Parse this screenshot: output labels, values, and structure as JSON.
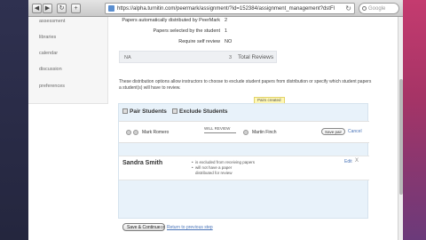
{
  "browser": {
    "url": "https://alpha.turnitin.com/peermark/assignment/?id=152384/assignment_management?dstFlag=1",
    "search_placeholder": "Google"
  },
  "sidebar": {
    "items": [
      {
        "label": "assessment"
      },
      {
        "label": "libraries"
      },
      {
        "label": "calendar"
      },
      {
        "label": "discussion"
      },
      {
        "label": "preferences"
      }
    ]
  },
  "settings": {
    "rows": [
      {
        "label": "Papers automatically distributed by PeerMark",
        "value": "2"
      },
      {
        "label": "Papers selected by the student",
        "value": "1"
      },
      {
        "label": "Require self review",
        "value": "NO"
      }
    ],
    "total": {
      "na": "NA",
      "count": "3",
      "label": "Total Reviews"
    }
  },
  "description": "These distribution options allow instructors to choose to exclude student papers from distribution or specify which student papers a student(s) will have to review.",
  "pairs_saved": "Pairs created",
  "tabs": {
    "pair_students": "Pair Students",
    "exclude_students": "Exclude Students"
  },
  "pair_row": {
    "reviewer": "Mark Romero",
    "will_review": "WILL REVIEW",
    "reviewee": "Martin Finch",
    "save_pair": "Save pair",
    "cancel": "Cancel"
  },
  "student": {
    "name": "Sandra Smith",
    "notes": [
      "is excluded from receiving papers",
      "will not have a paper distributed for review"
    ],
    "edit": "Edit",
    "delete": "X"
  },
  "footer": {
    "save_continue": "Save & Continue",
    "or": "or",
    "return_link": "Return to previous step"
  }
}
